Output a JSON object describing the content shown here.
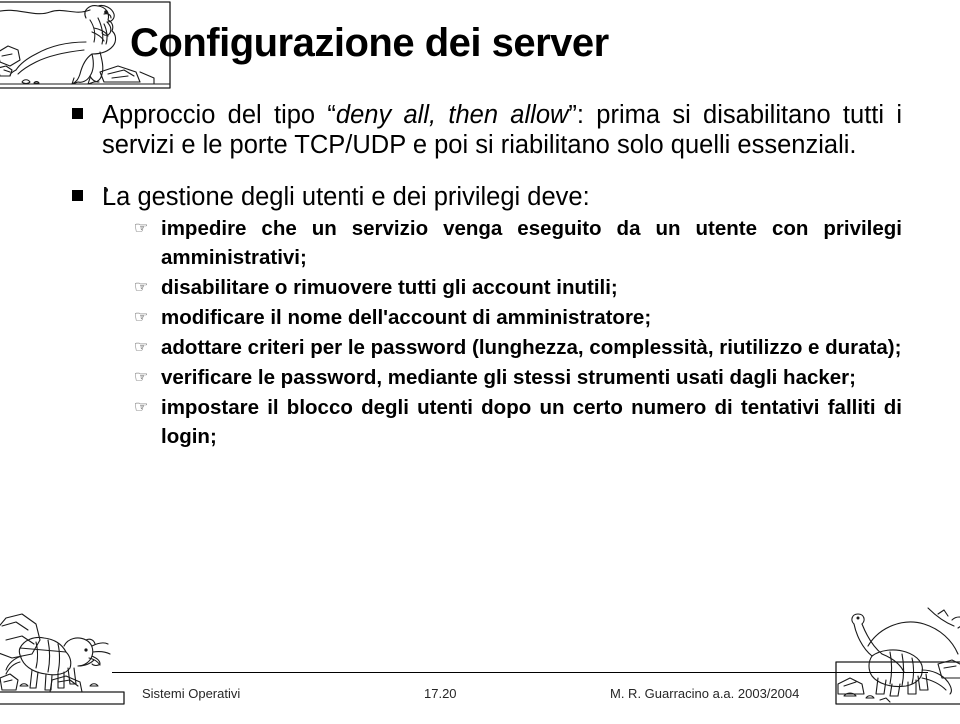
{
  "slide": {
    "title": "Configurazione dei server",
    "bullets": [
      {
        "marker": "black-square",
        "text_before": "Approccio del tipo “",
        "text_italic": "deny all, then allow",
        "text_after": "”: prima si disabilitano tutti i servizi e le porte TCP/UDP e poi si riabilitano solo quelli essenziali.",
        "sub_items": []
      },
      {
        "marker": "black-square",
        "text": "La gestione degli utenti e dei privilegi deve:",
        "sub_items": [
          {
            "marker": "pointing-hand",
            "text": "impedire che un servizio venga eseguito da un utente con privilegi amministrativi;"
          },
          {
            "marker": "pointing-hand",
            "text": "disabilitare o rimuovere tutti gli account inutili;"
          },
          {
            "marker": "pointing-hand",
            "text": "modificare il nome dell'account di amministratore;"
          },
          {
            "marker": "pointing-hand",
            "text": "adottare criteri per le password (lunghezza, complessità, riutilizzo e durata);"
          },
          {
            "marker": "pointing-hand",
            "text": "verificare le password, mediante gli stessi strumenti usati dagli hacker;"
          },
          {
            "marker": "pointing-hand",
            "text": "impostare il blocco degli utenti dopo un certo numero di tentativi falliti di login;"
          }
        ]
      }
    ]
  },
  "footer": {
    "left": "Sistemi Operativi",
    "center": "17.20",
    "right": "M. R. Guarracino a.a. 2003/2004"
  },
  "decorations": [
    {
      "name": "theropod-dinosaur-illustration",
      "position": "top-left"
    },
    {
      "name": "triceratops-dinosaur-illustration",
      "position": "bottom-left"
    },
    {
      "name": "sauropod-dinosaur-illustration",
      "position": "bottom-right"
    }
  ],
  "markers": {
    "square_glyph": "■",
    "hand_glyph": "☞"
  },
  "colors": {
    "text": "#000000",
    "footer_text": "#262626",
    "background": "#ffffff"
  }
}
